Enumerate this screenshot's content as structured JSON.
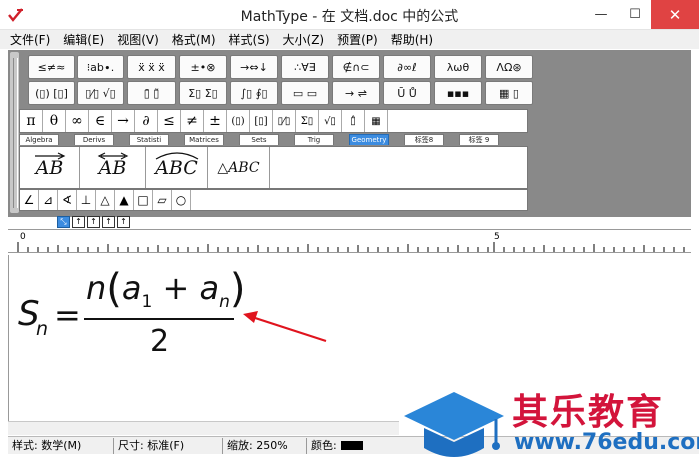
{
  "window": {
    "title": "MathType - 在 文档.doc 中的公式",
    "controls": {
      "minimize": "—",
      "maximize": "☐",
      "close": "✕"
    }
  },
  "menu": [
    "文件(F)",
    "编辑(E)",
    "视图(V)",
    "格式(M)",
    "样式(S)",
    "大小(Z)",
    "预置(P)",
    "帮助(H)"
  ],
  "toolbar": {
    "row1": [
      "≤≠≈",
      "⁝ab∙.",
      "ẍ ẍ ẍ",
      "±•⊗",
      "→⇔↓",
      "∴∀∃",
      "∉∩⊂",
      "∂∞ℓ",
      "λωθ",
      "ΛΩ⊛"
    ],
    "row2": [
      "(▯) [▯]",
      "▯⁄▯ √▯",
      "▯̄ ▯̃",
      "Σ▯ Σ▯",
      "∫▯ ∮▯",
      "▭ ▭",
      "→ ⇌",
      "Ū Ů",
      "▪▪▪",
      "▦ ▯"
    ],
    "row3_symbols": [
      "π",
      "θ",
      "∞",
      "∈",
      "→",
      "∂",
      "≤",
      "≠",
      "±",
      "(▯)",
      "[▯]",
      "▯⁄▯",
      "Σ▯",
      "√▯",
      "▯̂",
      "▦"
    ],
    "tabs": [
      {
        "label": "Algebra",
        "active": false
      },
      {
        "label": "Derivs",
        "active": false
      },
      {
        "label": "Statisti",
        "active": false
      },
      {
        "label": "Matrices",
        "active": false
      },
      {
        "label": "Sets",
        "active": false
      },
      {
        "label": "Trig",
        "active": false
      },
      {
        "label": "Geometry",
        "active": true
      },
      {
        "label": "标签8",
        "active": false
      },
      {
        "label": "标签 9",
        "active": false
      }
    ],
    "templates": [
      "AB",
      "AB",
      "ABC",
      "△ABC"
    ],
    "shapes": [
      "∠",
      "⊿",
      "∢",
      "⊥",
      "△",
      "▲",
      "□",
      "▱",
      "○"
    ],
    "size_buttons": [
      "⤡",
      "↑",
      "↑",
      "↑",
      "↑"
    ]
  },
  "ruler": {
    "marks": [
      "0",
      "5"
    ]
  },
  "formula": {
    "lhs_var": "S",
    "lhs_sub": "n",
    "equals": "=",
    "num_n": "n",
    "open_paren": "(",
    "a": "a",
    "sub_1": "1",
    "plus": "+",
    "sub_n": "n",
    "close_paren": ")",
    "denominator": "2"
  },
  "status": {
    "style": "样式: 数学(M)",
    "size": "尺寸: 标准(F)",
    "zoom": "缩放: 250%",
    "color": "颜色:",
    "color_value": "#000000"
  },
  "watermark": {
    "cn": "其乐教育",
    "url": "www.76edu.com"
  },
  "colors": {
    "annotation_arrow": "#e0141e",
    "active_tab": "#3c8ce0",
    "close_button": "#e04343"
  }
}
